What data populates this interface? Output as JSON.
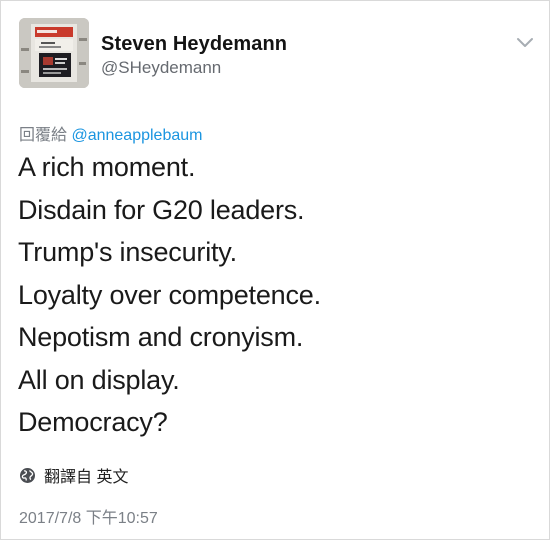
{
  "user": {
    "name": "Steven Heydemann",
    "handle": "@SHeydemann"
  },
  "reply": {
    "prefix": "回覆給",
    "mention": "@anneapplebaum"
  },
  "tweet": {
    "lines": [
      "A rich moment.",
      "Disdain for G20 leaders.",
      "Trump's insecurity.",
      "Loyalty over competence.",
      "Nepotism and cronyism.",
      "All on display.",
      "Democracy?"
    ]
  },
  "translate": {
    "label": "翻譯自 英文",
    "icon": "globe-icon"
  },
  "timestamp": "2017/7/8 下午10:57",
  "icons": {
    "menu": "chevron-down-icon"
  },
  "colors": {
    "mention": "#1b95e0",
    "muted": "#7b8087",
    "text": "#1a1a1a"
  }
}
